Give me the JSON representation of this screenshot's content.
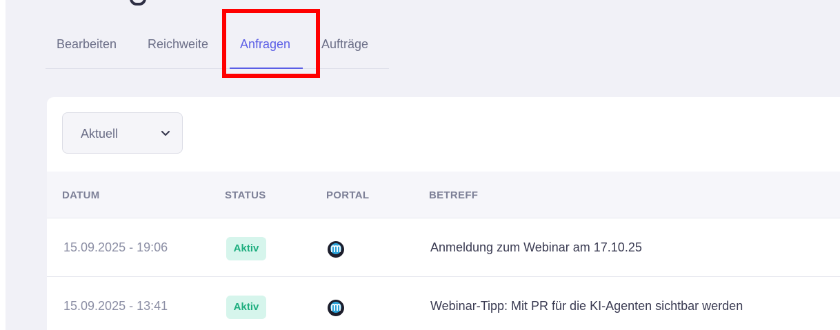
{
  "tabs": [
    {
      "label": "Bearbeiten",
      "active": false
    },
    {
      "label": "Reichweite",
      "active": false
    },
    {
      "label": "Anfragen",
      "active": true
    },
    {
      "label": "Aufträge",
      "active": false
    }
  ],
  "filter": {
    "selected": "Aktuell",
    "icon": "chevron-down-icon"
  },
  "table": {
    "headers": [
      "DATUM",
      "STATUS",
      "PORTAL",
      "BETREFF"
    ],
    "rows": [
      {
        "date": "15.09.2025 - 19:06",
        "status": "Aktiv",
        "portal_icon": "portal-logo-icon",
        "subject": "Anmeldung zum Webinar am 17.10.25"
      },
      {
        "date": "15.09.2025 - 13:41",
        "status": "Aktiv",
        "portal_icon": "portal-logo-icon",
        "subject": "Webinar-Tipp: Mit PR für die KI-Agenten sichtbar werden"
      }
    ]
  },
  "colors": {
    "accent": "#5b5ee6",
    "highlight": "#ff0000",
    "badge_bg": "#d6f5ec",
    "badge_text": "#1eae7f"
  }
}
